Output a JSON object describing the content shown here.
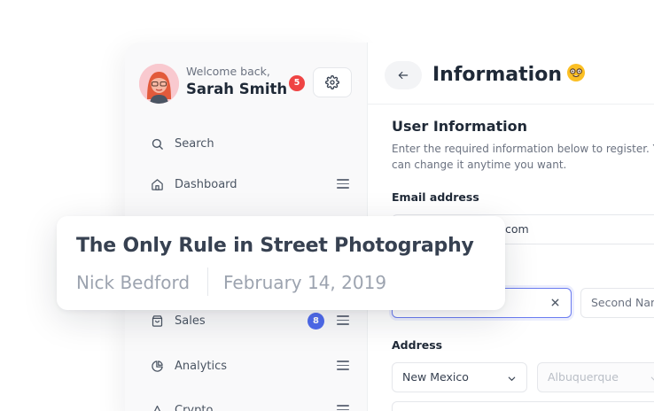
{
  "user": {
    "welcome": "Welcome back,",
    "name": "Sarah Smith",
    "notifications": "5"
  },
  "sidebar": {
    "search_label": "Search",
    "items": [
      {
        "label": "Dashboard",
        "icon": "home-icon"
      },
      {
        "label": "Sales",
        "icon": "bag-icon",
        "badge": "8"
      },
      {
        "label": "Analytics",
        "icon": "pie-chart-icon"
      },
      {
        "label": "Crypto",
        "icon": "crypto-icon"
      }
    ]
  },
  "main": {
    "title": "Information",
    "title_emoji": "nerd-face-emoji",
    "section_title": "User Information",
    "section_desc": "Enter the required information below to register. You can change it anytime you want.",
    "email_label": "Email address",
    "email_value_suffix": "com",
    "name_second_placeholder": "Second Name",
    "address_label": "Address",
    "state_value": "New Mexico",
    "city_value": "Albuquerque"
  },
  "article": {
    "title": "The Only Rule in Street Photography",
    "author": "Nick Bedford",
    "date": "February 14,  2019"
  },
  "colors": {
    "notification_badge": "#ef4444",
    "count_badge": "#4f6bed",
    "active_input_border": "#6b7cf0",
    "avatar_bg": "#f9c9cf"
  }
}
